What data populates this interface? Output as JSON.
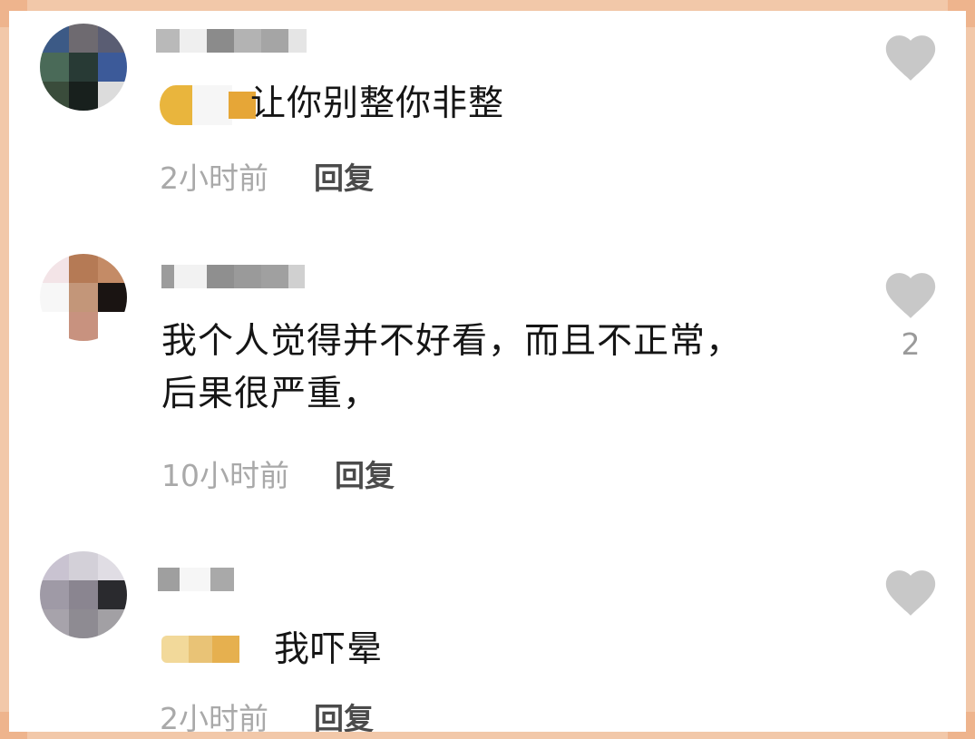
{
  "comments": [
    {
      "text": "让你别整你非整",
      "time": "2小时前",
      "reply_label": "回复",
      "like_count": ""
    },
    {
      "text_lines": [
        "我个人觉得并不好看，而且不正常，",
        "后果很严重，"
      ],
      "time": "10小时前",
      "reply_label": "回复",
      "like_count": "2"
    },
    {
      "text": "我吓晕",
      "time": "2小时前",
      "reply_label": "回复",
      "like_count": ""
    }
  ],
  "colors": {
    "frame": "#f2c8a9",
    "like_icon": "#c8c8c8",
    "time_text": "#a9a9a9",
    "reply_text": "#4b4b4b"
  },
  "icons": {
    "like": "heart-icon"
  }
}
